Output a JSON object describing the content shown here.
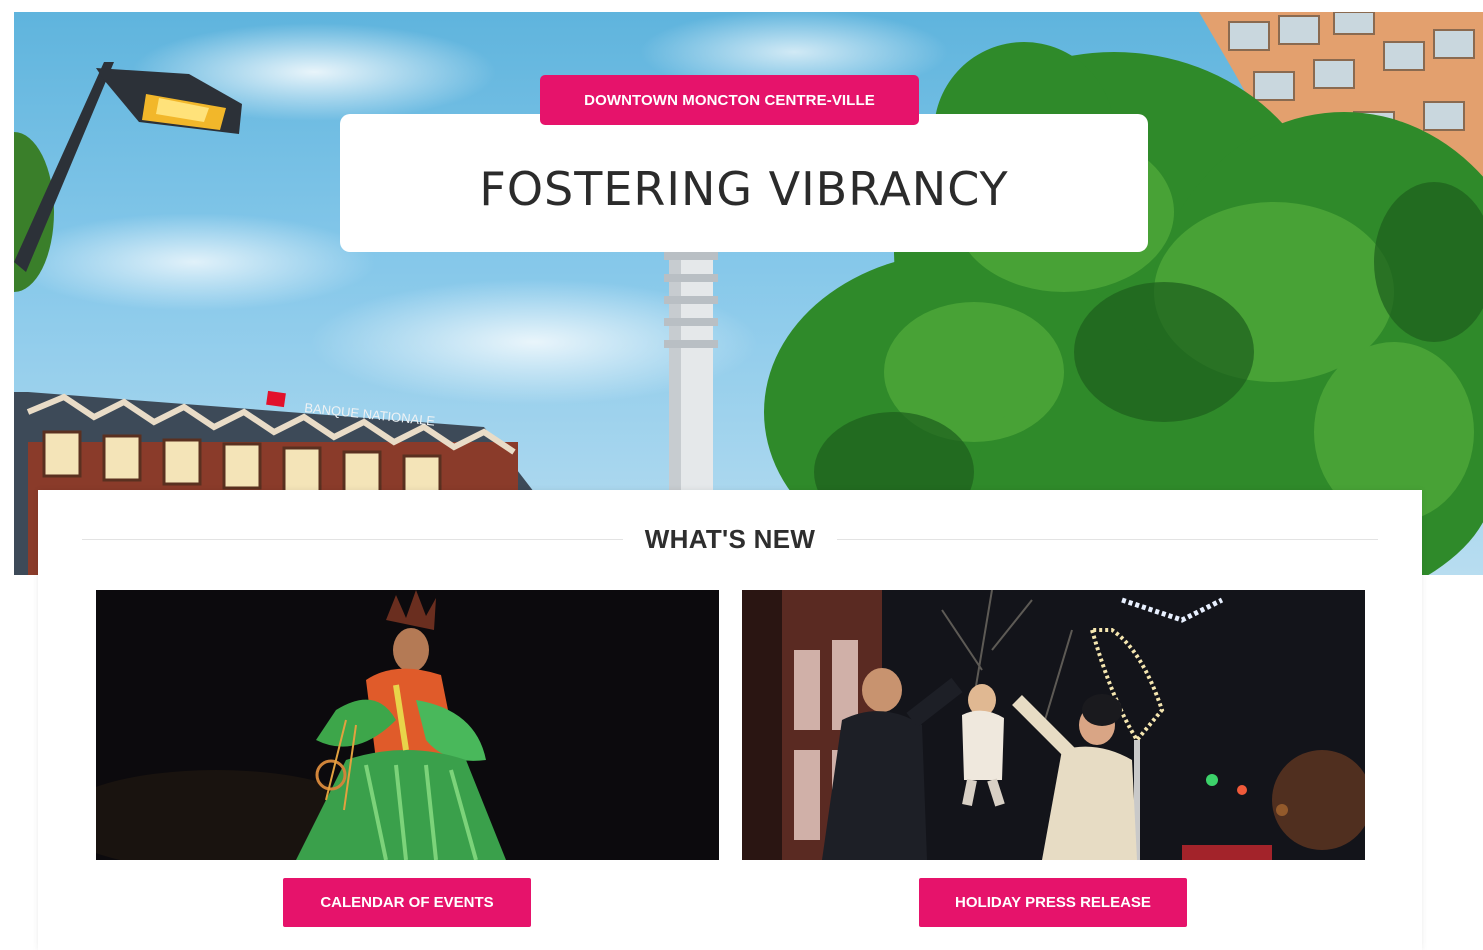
{
  "hero": {
    "eyebrow": "DOWNTOWN MONCTON CENTRE-VILLE",
    "title": "FOSTERING VIBRANCY",
    "sign_text": "BANQUE NATIONALE"
  },
  "whats_new": {
    "heading": "WHAT'S NEW",
    "cards": [
      {
        "image": "powwow-dancer-photo",
        "button_label": "CALENDAR OF EVENTS"
      },
      {
        "image": "holiday-lights-family-photo",
        "button_label": "HOLIDAY PRESS RELEASE"
      }
    ]
  },
  "colors": {
    "accent": "#e6136b",
    "title_text": "#2b2b2b",
    "sky": "#86c8ea",
    "foliage": "#2f8a2a"
  }
}
